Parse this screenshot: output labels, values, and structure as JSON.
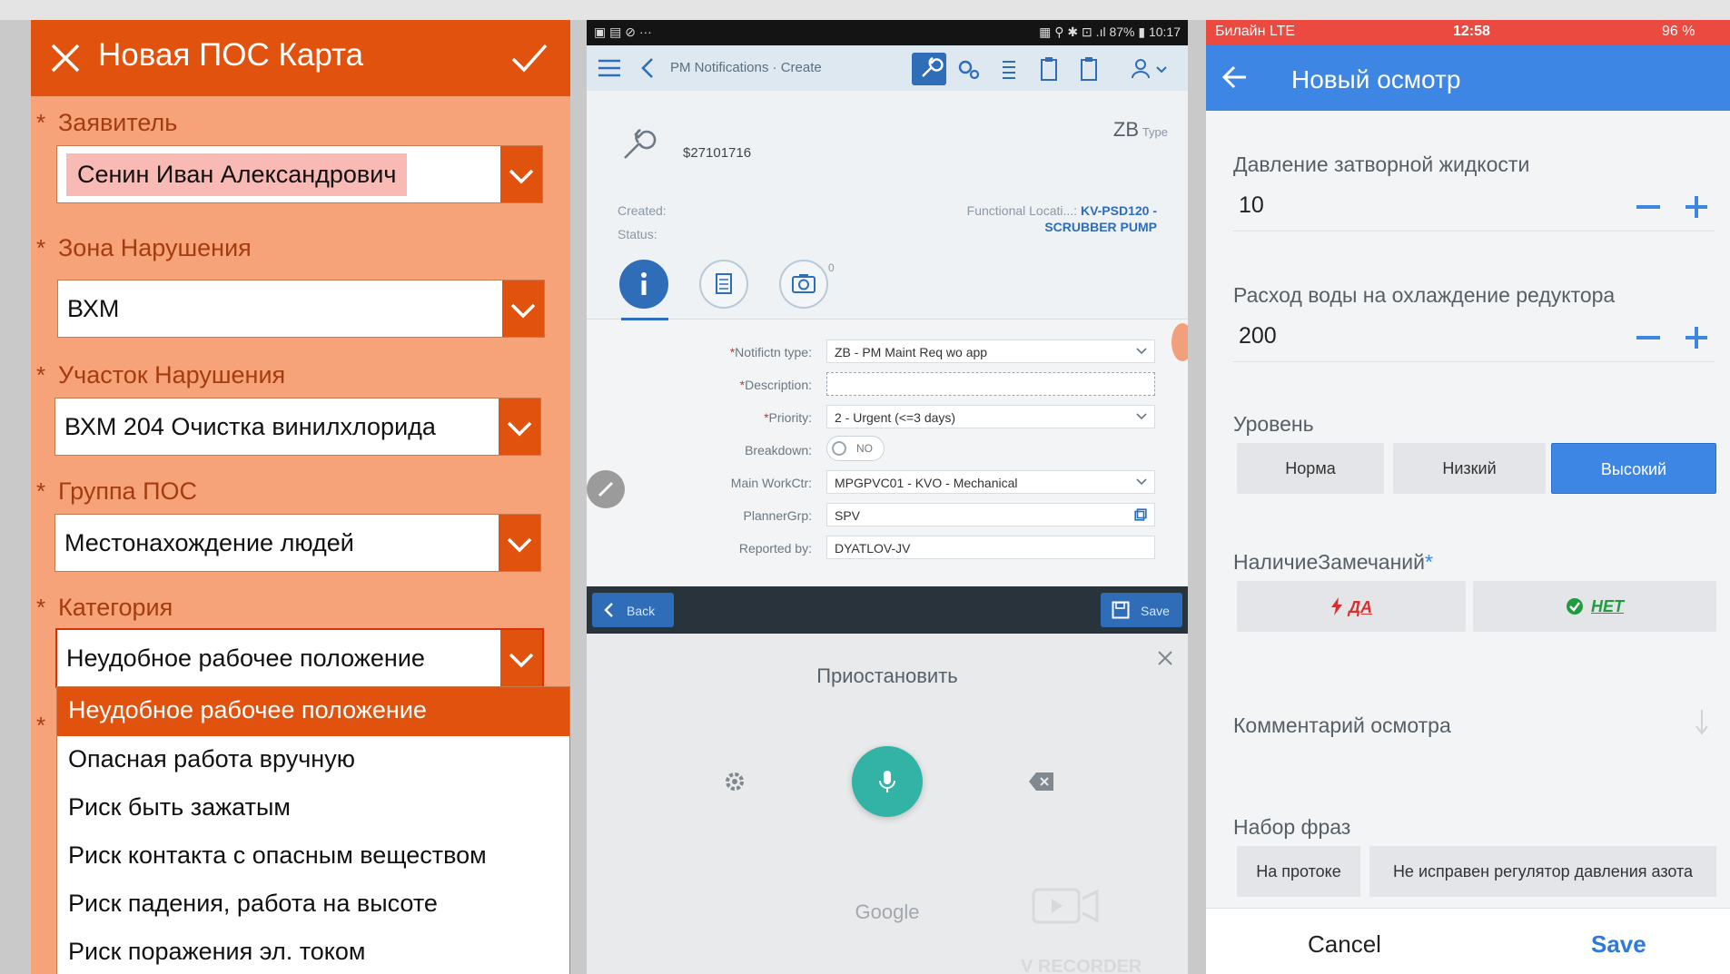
{
  "panel_left": {
    "title": "Новая ПОС Карта",
    "fields": [
      {
        "label": "Заявитель",
        "value": "Сенин Иван Александрович"
      },
      {
        "label": "Зона Нарушения",
        "value": "ВХМ"
      },
      {
        "label": "Участок Нарушения",
        "value": "ВХМ 204 Очистка винилхлорида"
      },
      {
        "label": "Группа ПОС",
        "value": "Местонахождение людей"
      },
      {
        "label": "Категория",
        "value": "Неудобное рабочее положение"
      }
    ],
    "required_mark": "*",
    "dropdown_options": [
      "Неудобное рабочее положение",
      "Опасная работа вручную",
      "Риск быть зажатым",
      "Риск контакта с опасным веществом",
      "Риск падения, работа на высоте",
      "Риск поражения эл. током"
    ],
    "colors": {
      "accent": "#e0520d",
      "background": "#f7a37a"
    }
  },
  "panel_middle": {
    "statusbar": {
      "left": "▣ ▤ ⊘  ···",
      "right": "▦ ⚲ ✱ ⊡ .ıl 87% ▮ 10:17"
    },
    "toolbar": {
      "title": "PM Notifications · Create"
    },
    "notification": {
      "number": "$27101716",
      "type_code": "ZB",
      "type_label": "Type",
      "created_label": "Created:",
      "status_label": "Status:",
      "func_loc_label": "Functional Locati...:",
      "func_loc_value": "KV-PSD120 -",
      "func_loc_value2": "SCRUBBER PUMP",
      "attachments_count": "0"
    },
    "form": {
      "notif_type_label": "Notifictn type:",
      "notif_type_value": "ZB - PM Maint Req wo app",
      "description_label": "Description:",
      "description_value": "",
      "priority_label": "Priority:",
      "priority_value": "2 - Urgent (<=3 days)",
      "breakdown_label": "Breakdown:",
      "breakdown_value": "NO",
      "workctr_label": "Main WorkCtr:",
      "workctr_value": "MPGPVC01 - KVO - Mechanical",
      "plannergrp_label": "PlannerGrp:",
      "plannergrp_value": "SPV",
      "reportedby_label": "Reported by:",
      "reportedby_value": "DYATLOV-JV",
      "required_mark": "*"
    },
    "bottom_bar": {
      "back_label": "Back",
      "save_label": "Save"
    },
    "voice": {
      "prompt": "Приостановить",
      "provider": "Google",
      "recorder_watermark": "V RECORDER"
    }
  },
  "panel_right": {
    "statusbar": {
      "carrier": "Билайн  LTE",
      "time": "12:58",
      "battery": "96 %"
    },
    "title": "Новый осмотр",
    "fields": [
      {
        "label": "Давление затворной жидкости",
        "value": "10"
      },
      {
        "label": "Расход воды на охлаждение редуктора",
        "value": "200"
      }
    ],
    "level_label": "Уровень",
    "level_options": [
      "Норма",
      "Низкий",
      "Высокий"
    ],
    "remarks_label": "НаличиеЗамечаний",
    "remarks_required": "*",
    "remarks_yes": "ДА",
    "remarks_no": "НЕТ",
    "comment_label": "Комментарий осмотра",
    "phrases_label": "Набор фраз",
    "phrases": [
      "На протоке",
      "Не исправен регулятор давления азота"
    ],
    "cancel_label": "Cancel",
    "save_label": "Save",
    "colors": {
      "accent": "#3d86e3",
      "statusbar": "#ea4a3f"
    }
  }
}
